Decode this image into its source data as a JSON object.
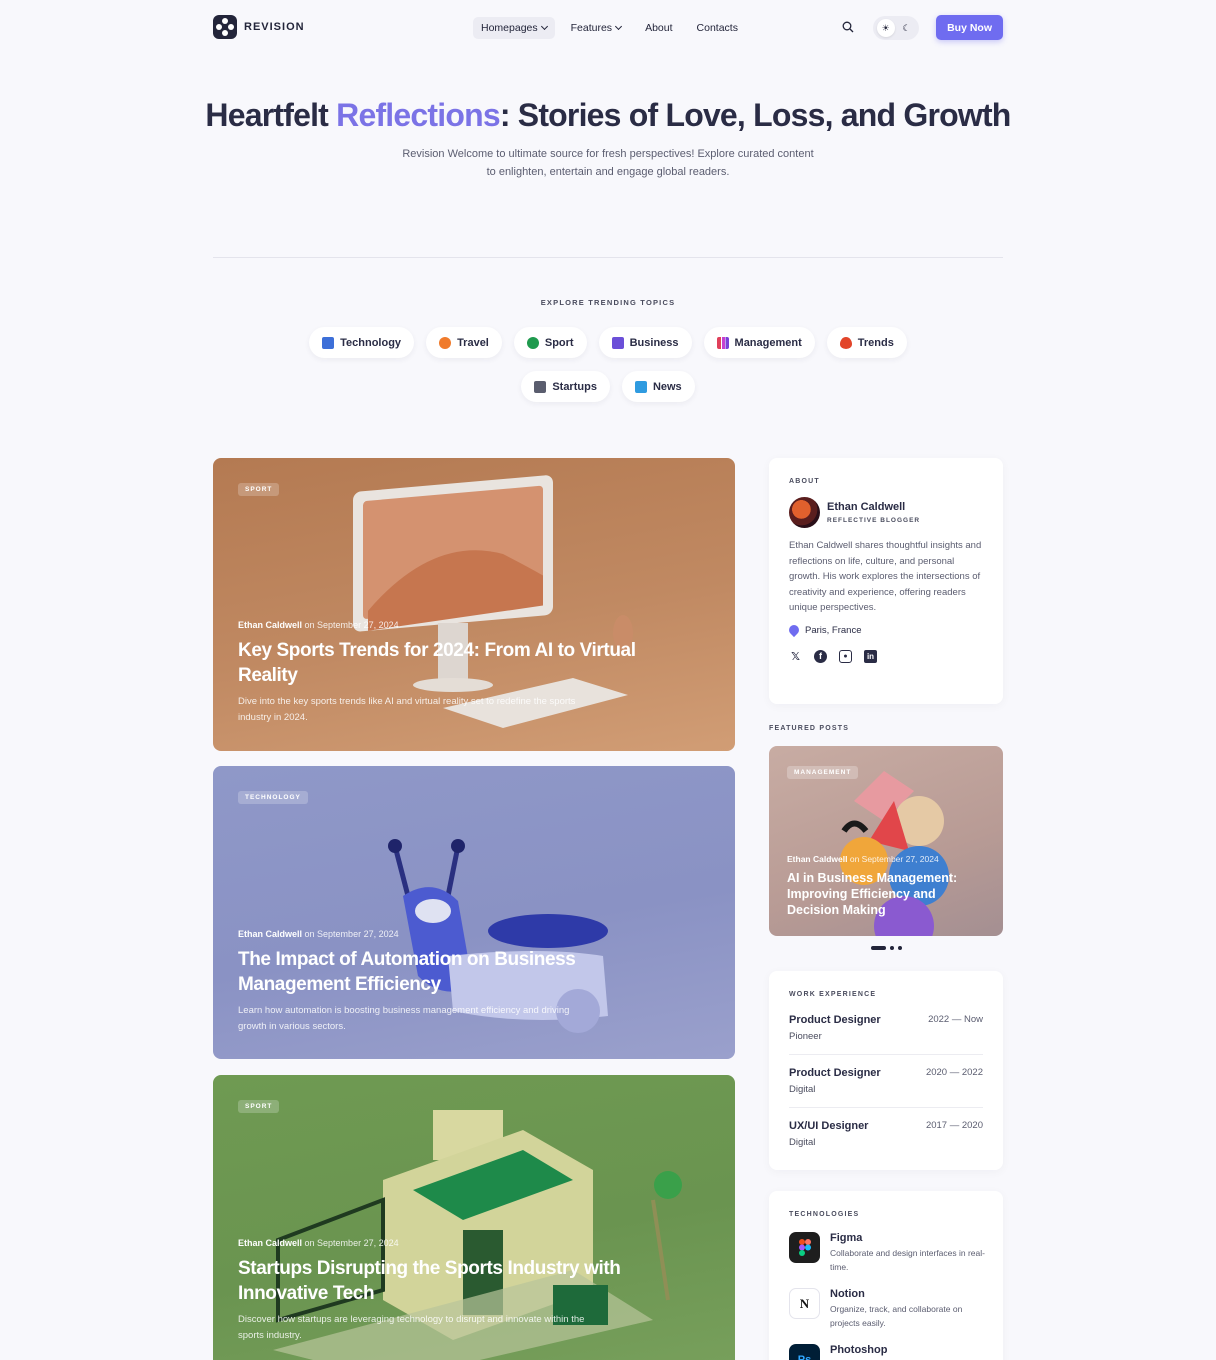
{
  "brand": {
    "name": "REVISION"
  },
  "nav": {
    "items": [
      {
        "label": "Homepages",
        "dropdown": true,
        "active": true
      },
      {
        "label": "Features",
        "dropdown": true,
        "active": false
      },
      {
        "label": "About",
        "dropdown": false,
        "active": false
      },
      {
        "label": "Contacts",
        "dropdown": false,
        "active": false
      }
    ],
    "buy_label": "Buy Now"
  },
  "hero": {
    "title_pre": "Heartfelt ",
    "title_accent": "Reflections",
    "title_post": ": Stories of Love, Loss, and Growth",
    "subtitle": "Revision Welcome to ultimate source for fresh perspectives! Explore curated content to enlighten, entertain and engage global readers."
  },
  "topics": {
    "label": "EXPLORE TRENDING TOPICS",
    "items": [
      "Technology",
      "Travel",
      "Sport",
      "Business",
      "Management",
      "Trends",
      "Startups",
      "News"
    ]
  },
  "posts": [
    {
      "tag": "SPORT",
      "author": "Ethan Caldwell",
      "date": "on September 27, 2024",
      "title": "Key Sports Trends for 2024: From AI to Virtual Reality",
      "desc": "Dive into the key sports trends like AI and virtual reality set to redefine the sports industry in 2024."
    },
    {
      "tag": "TECHNOLOGY",
      "author": "Ethan Caldwell",
      "date": "on September 27, 2024",
      "title": "The Impact of Automation on Business Management Efficiency",
      "desc": "Learn how automation is boosting business management efficiency and driving growth in various sectors."
    },
    {
      "tag": "SPORT",
      "author": "Ethan Caldwell",
      "date": "on September 27, 2024",
      "title": "Startups Disrupting the Sports Industry with Innovative Tech",
      "desc": "Discover how startups are leveraging technology to disrupt and innovate within the sports industry."
    }
  ],
  "about": {
    "label": "ABOUT",
    "name": "Ethan Caldwell",
    "role": "REFLECTIVE BLOGGER",
    "bio": "Ethan Caldwell shares thoughtful insights and reflections on life, culture, and personal growth. His work explores the intersections of creativity and experience, offering readers unique perspectives.",
    "location": "Paris, France"
  },
  "featured": {
    "label": "FEATURED POSTS",
    "tag": "MANAGEMENT",
    "author": "Ethan Caldwell",
    "date": "on September 27, 2024",
    "title": "AI in Business Management: Improving Efficiency and Decision Making"
  },
  "work": {
    "label": "WORK EXPERIENCE",
    "jobs": [
      {
        "title": "Product Designer",
        "company": "Pioneer",
        "years": "2022 — Now"
      },
      {
        "title": "Product Designer",
        "company": "Digital",
        "years": "2020 — 2022"
      },
      {
        "title": "UX/UI Designer",
        "company": "Digital",
        "years": "2017 — 2020"
      }
    ]
  },
  "technologies": {
    "label": "TECHNOLOGIES",
    "items": [
      {
        "name": "Figma",
        "desc": "Collaborate and design interfaces in real-time."
      },
      {
        "name": "Notion",
        "desc": "Organize, track, and collaborate on projects easily."
      },
      {
        "name": "Photoshop",
        "desc": ""
      }
    ]
  },
  "colors": {
    "accent": "#6f6cf0",
    "heading": "#2a2c45",
    "background": "#f8f8fc"
  }
}
